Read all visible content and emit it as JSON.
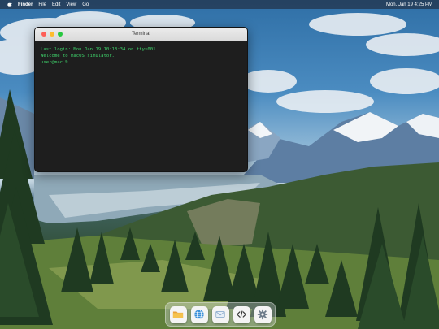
{
  "menubar": {
    "apple_icon": "apple-icon",
    "app_name": "Finder",
    "menus": [
      "File",
      "Edit",
      "View",
      "Go"
    ],
    "clock": "Mon, Jan 19 4:25 PM"
  },
  "terminal": {
    "title": "Terminal",
    "lines": [
      "Last login: Mon Jan 19 10:13:34 on ttys001",
      "Welcome to macOS simulator."
    ],
    "prompt": "user@mac % "
  },
  "dock": {
    "items": [
      {
        "name": "finder",
        "icon": "folder-icon"
      },
      {
        "name": "browser",
        "icon": "globe-icon"
      },
      {
        "name": "mail",
        "icon": "envelope-icon"
      },
      {
        "name": "code-editor",
        "icon": "code-icon"
      },
      {
        "name": "settings",
        "icon": "gear-icon"
      }
    ]
  },
  "colors": {
    "terminal_text": "#3fd36b",
    "terminal_bg": "#1e1e1e",
    "close": "#fe5f57",
    "minimize": "#febc2e",
    "zoom": "#28c840"
  }
}
